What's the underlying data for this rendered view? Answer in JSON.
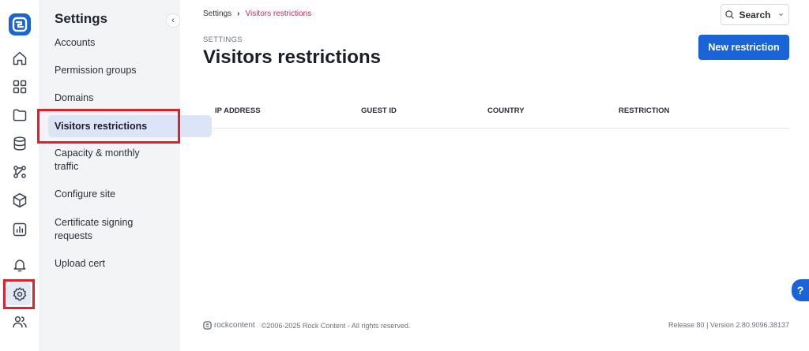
{
  "rail": {
    "icons": [
      "app-logo-icon",
      "home-icon",
      "grid-icon",
      "folder-icon",
      "database-icon",
      "workflow-icon",
      "cube-icon",
      "analytics-icon",
      "bell-icon",
      "settings-icon",
      "users-icon"
    ]
  },
  "panel": {
    "title": "Settings",
    "collapse_glyph": "‹",
    "items": [
      {
        "label": "Accounts"
      },
      {
        "label": "Permission groups"
      },
      {
        "label": "Domains"
      },
      {
        "label": "Visitors restrictions"
      },
      {
        "label": "Capacity & monthly traffic"
      },
      {
        "label": "Configure site"
      },
      {
        "label": "Certificate signing requests"
      },
      {
        "label": "Upload cert"
      }
    ]
  },
  "header": {
    "breadcrumb_root": "Settings",
    "breadcrumb_sep": "›",
    "breadcrumb_current": "Visitors restrictions",
    "search_label": "Search",
    "search_caret": "⌄"
  },
  "page": {
    "eyebrow": "SETTINGS",
    "title": "Visitors restrictions",
    "new_button": "New restriction"
  },
  "table": {
    "columns": [
      "IP ADDRESS",
      "GUEST ID",
      "COUNTRY",
      "RESTRICTION"
    ]
  },
  "footer": {
    "brand": "rockcontent",
    "copyright": "©2006-2025 Rock Content - All rights reserved.",
    "release": "Release 80 | Version 2.80.9096.38137"
  },
  "help_glyph": "?",
  "colors": {
    "accent": "#1b64d8",
    "breadcrumb_current": "#d6205a",
    "highlight_box": "#e0202a"
  }
}
